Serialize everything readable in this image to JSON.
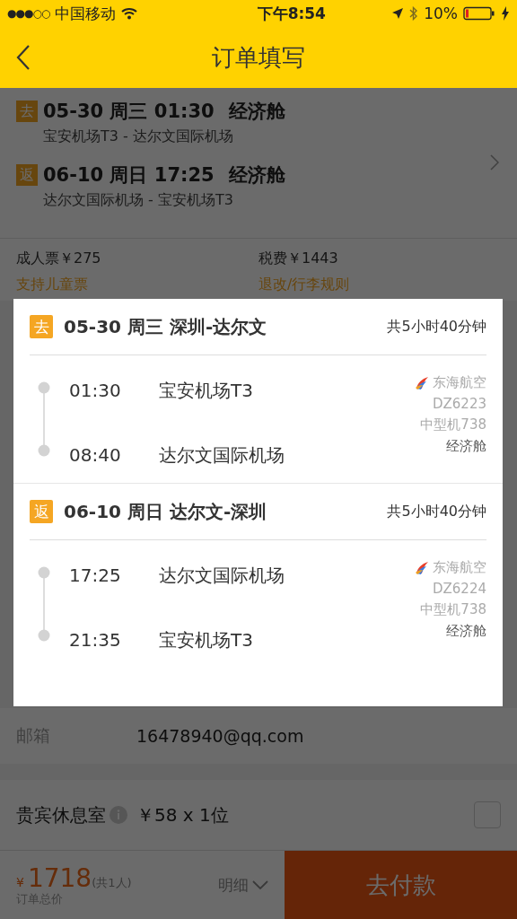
{
  "status_bar": {
    "signal": "●●●○○",
    "carrier": "中国移动",
    "time": "下午8:54",
    "battery": "10%"
  },
  "nav": {
    "title": "订单填写"
  },
  "flights": [
    {
      "tag": "去",
      "title": "05-30 周三 01:30",
      "cabin": "经济舱",
      "route": "宝安机场T3 - 达尔文国际机场"
    },
    {
      "tag": "返",
      "title": "06-10 周日 17:25",
      "cabin": "经济舱",
      "route": "达尔文国际机场 - 宝安机场T3"
    }
  ],
  "prices": [
    {
      "text": "成人票￥275",
      "link": "支持儿童票"
    },
    {
      "text": "税费￥1443",
      "link": "退改/行李规则"
    }
  ],
  "email": {
    "label": "邮箱",
    "value": "16478940@qq.com"
  },
  "lounge": {
    "label": "贵宾休息室",
    "price": "￥58 x 1位",
    "checked": false
  },
  "bottom_bar": {
    "currency": "¥",
    "total": "1718",
    "count": "(共1人)",
    "caption": "订单总价",
    "detail": "明细",
    "pay": "去付款"
  },
  "modal": {
    "segments": [
      {
        "tag": "去",
        "title": "05-30 周三 深圳-达尔文",
        "duration": "共5小时40分钟",
        "stops": [
          {
            "time": "01:30",
            "airport": "宝安机场T3"
          },
          {
            "time": "08:40",
            "airport": "达尔文国际机场"
          }
        ],
        "airline": "东海航空",
        "flight_no": "DZ6223",
        "aircraft": "中型机738",
        "cabin": "经济舱"
      },
      {
        "tag": "返",
        "title": "06-10 周日 达尔文-深圳",
        "duration": "共5小时40分钟",
        "stops": [
          {
            "time": "17:25",
            "airport": "达尔文国际机场"
          },
          {
            "time": "21:35",
            "airport": "宝安机场T3"
          }
        ],
        "airline": "东海航空",
        "flight_no": "DZ6224",
        "aircraft": "中型机738",
        "cabin": "经济舱"
      }
    ]
  }
}
